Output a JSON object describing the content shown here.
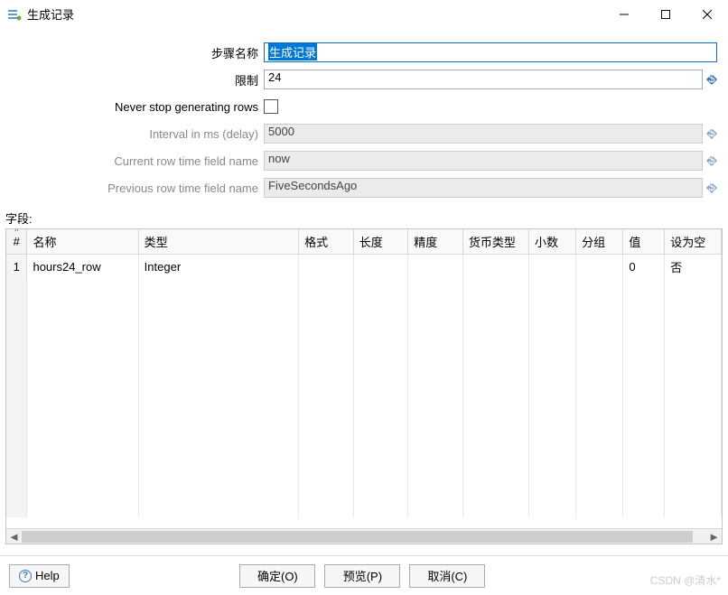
{
  "window": {
    "title": "生成记录"
  },
  "form": {
    "step_name_label": "步骤名称",
    "step_name_value": "生成记录",
    "limit_label": "限制",
    "limit_value": "24",
    "never_stop_label": "Never stop generating rows",
    "interval_label": "Interval in ms (delay)",
    "interval_value": "5000",
    "current_row_label": "Current row time field name",
    "current_row_value": "now",
    "previous_row_label": "Previous row time field name",
    "previous_row_value": "FiveSecondsAgo"
  },
  "fields_section_label": "字段:",
  "table": {
    "columns": [
      "#",
      "名称",
      "类型",
      "格式",
      "长度",
      "精度",
      "货币类型",
      "小数",
      "分组",
      "值",
      "设为空"
    ],
    "rows": [
      {
        "num": "1",
        "name": "hours24_row",
        "type": "Integer",
        "format": "",
        "length": "",
        "precision": "",
        "currency": "",
        "decimal": "",
        "group": "",
        "value": "0",
        "setnull": "否"
      }
    ]
  },
  "buttons": {
    "help": "Help",
    "ok": "确定(O)",
    "preview": "预览(P)",
    "cancel": "取消(C)"
  },
  "watermark": "CSDN @清水*"
}
